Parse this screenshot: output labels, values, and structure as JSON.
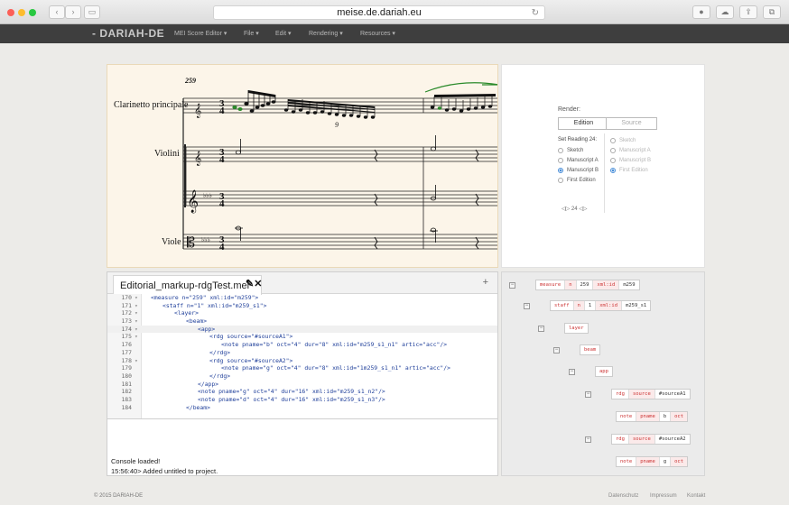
{
  "browser": {
    "url": "meise.de.dariah.eu",
    "reload_icon": "reload-icon"
  },
  "nav": {
    "brand": "- DARIAH-DE",
    "menus": [
      "MEI Score Editor ▾",
      "File ▾",
      "Edit ▾",
      "Rendering ▾",
      "Resources ▾"
    ]
  },
  "score": {
    "measure_number": "259",
    "tuplet": "9",
    "instruments": [
      "Clarinetto principale",
      "Violini",
      "Viole"
    ]
  },
  "render": {
    "title": "Render:",
    "tabs": [
      "Edition",
      "Source"
    ],
    "set_reading": "Set Reading 24:",
    "left_options": [
      {
        "label": "Sketch",
        "checked": false
      },
      {
        "label": "Manuscript A",
        "checked": false
      },
      {
        "label": "Manuscript B",
        "checked": true
      },
      {
        "label": "First Edition",
        "checked": false
      }
    ],
    "right_options": [
      {
        "label": "Sketch",
        "checked": false
      },
      {
        "label": "Manuscript A",
        "checked": false
      },
      {
        "label": "Manuscript B",
        "checked": false
      },
      {
        "label": "First Edition",
        "checked": true
      }
    ],
    "pager": "◁▷  24  ◁▷"
  },
  "editor": {
    "filename": "Editorial_markup-rdgTest.mei",
    "add_label": "+",
    "lines": [
      {
        "n": "170",
        "fold": "▾",
        "text": "<measure n=\"259\" xml:id=\"m259\">",
        "indent": 0
      },
      {
        "n": "171",
        "fold": "▾",
        "text": "<staff n=\"1\" xml:id=\"m259_s1\">",
        "indent": 2
      },
      {
        "n": "172",
        "fold": "▾",
        "text": "<layer>",
        "indent": 4
      },
      {
        "n": "173",
        "fold": "▾",
        "text": "<beam>",
        "indent": 6
      },
      {
        "n": "174",
        "fold": "▾",
        "text": "<app>",
        "indent": 8,
        "hl": true
      },
      {
        "n": "175",
        "fold": "▾",
        "text": "<rdg source=\"#sourceA1\">",
        "indent": 10
      },
      {
        "n": "176",
        "fold": "",
        "text": "<note pname=\"b\" oct=\"4\" dur=\"8\" xml:id=\"m259_s1_n1\" artic=\"acc\"/>",
        "indent": 12
      },
      {
        "n": "177",
        "fold": "",
        "text": "</rdg>",
        "indent": 10
      },
      {
        "n": "178",
        "fold": "▾",
        "text": "<rdg source=\"#sourceA2\">",
        "indent": 10
      },
      {
        "n": "179",
        "fold": "",
        "text": "<note pname=\"g\" oct=\"4\" dur=\"8\" xml:id=\"1m259_s1_n1\" artic=\"acc\"/>",
        "indent": 12
      },
      {
        "n": "180",
        "fold": "",
        "text": "</rdg>",
        "indent": 10
      },
      {
        "n": "181",
        "fold": "",
        "text": "</app>",
        "indent": 8
      },
      {
        "n": "182",
        "fold": "",
        "text": "<note pname=\"g\" oct=\"4\" dur=\"16\" xml:id=\"m259_s1_n2\"/>",
        "indent": 8
      },
      {
        "n": "183",
        "fold": "",
        "text": "<note pname=\"d\" oct=\"4\" dur=\"16\" xml:id=\"m259_s1_n3\"/>",
        "indent": 8
      },
      {
        "n": "184",
        "fold": "",
        "text": "</beam>",
        "indent": 6
      }
    ],
    "console": [
      "Console loaded!",
      "15:56:40> Added untitled to project."
    ]
  },
  "tree": {
    "nodes": [
      {
        "tog": "⊟",
        "cells": [
          {
            "t": "measure",
            "c": "tag"
          },
          {
            "t": "n",
            "c": "an"
          },
          {
            "t": "259",
            "c": "av"
          },
          {
            "t": "xml:id",
            "c": "an"
          },
          {
            "t": "m259",
            "c": "av"
          }
        ]
      },
      {
        "tog": "⊟",
        "cells": [
          {
            "t": "staff",
            "c": "tag"
          },
          {
            "t": "n",
            "c": "an"
          },
          {
            "t": "1",
            "c": "av"
          },
          {
            "t": "xml:id",
            "c": "an"
          },
          {
            "t": "m259_s1",
            "c": "av"
          }
        ]
      },
      {
        "tog": "⊟",
        "cells": [
          {
            "t": "layer",
            "c": "tag"
          }
        ]
      },
      {
        "tog": "⊟",
        "cells": [
          {
            "t": "beam",
            "c": "tag"
          }
        ]
      },
      {
        "tog": "⊟",
        "cells": [
          {
            "t": "app",
            "c": "tag"
          }
        ]
      },
      {
        "tog": "⊟",
        "cells": [
          {
            "t": "rdg",
            "c": "tag"
          },
          {
            "t": "source",
            "c": "an"
          },
          {
            "t": "#sourceA1",
            "c": "av"
          }
        ]
      },
      {
        "tog": "",
        "cells": [
          {
            "t": "note",
            "c": "tag"
          },
          {
            "t": "pname",
            "c": "an"
          },
          {
            "t": "b",
            "c": "av"
          },
          {
            "t": "oct",
            "c": "an"
          }
        ]
      },
      {
        "tog": "⊟",
        "cells": [
          {
            "t": "rdg",
            "c": "tag"
          },
          {
            "t": "source",
            "c": "an"
          },
          {
            "t": "#sourceA2",
            "c": "av"
          }
        ]
      },
      {
        "tog": "",
        "cells": [
          {
            "t": "note",
            "c": "tag"
          },
          {
            "t": "pname",
            "c": "an"
          },
          {
            "t": "g",
            "c": "av"
          },
          {
            "t": "oct",
            "c": "an"
          }
        ]
      }
    ]
  },
  "footer": {
    "copyright": "© 2015 DARIAH-DE",
    "links": [
      "Datenschutz",
      "Impressum",
      "Kontakt"
    ]
  }
}
